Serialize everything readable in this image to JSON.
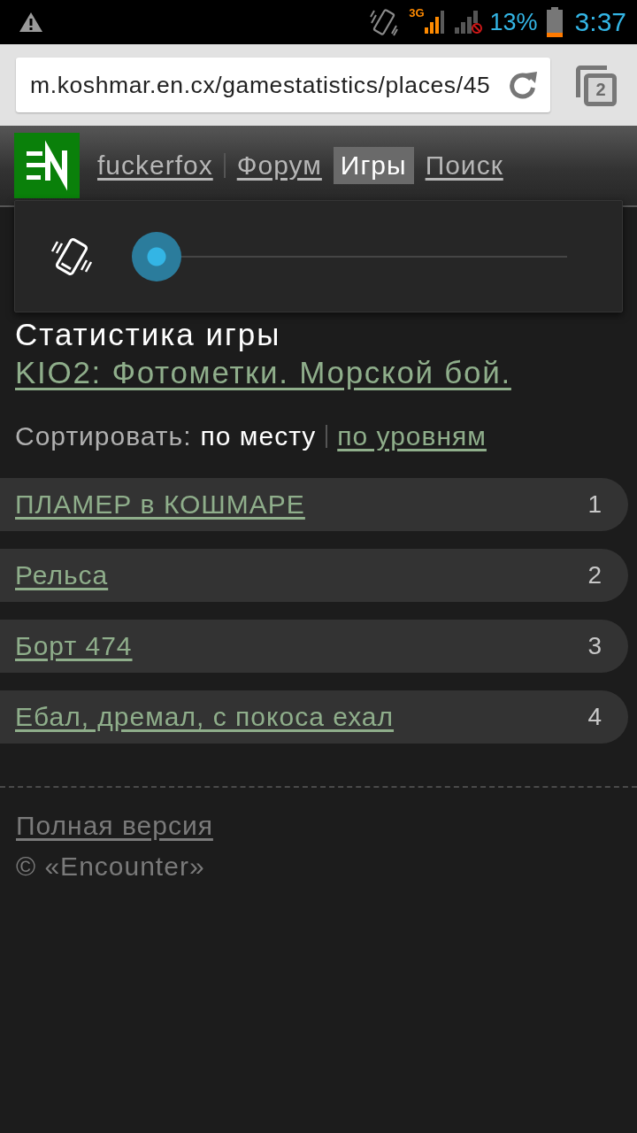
{
  "status_bar": {
    "network_type": "3G",
    "battery_percent": "13%",
    "time": "3:37"
  },
  "browser": {
    "url": "m.koshmar.en.cx/gamestatistics/places/45",
    "tab_count": "2"
  },
  "header": {
    "nav": [
      {
        "label": "fuckerfox",
        "kind": "user",
        "selected": false
      },
      {
        "label": "Форум",
        "kind": "link",
        "selected": false
      },
      {
        "label": "Игры",
        "kind": "link",
        "selected": true
      },
      {
        "label": "Поиск",
        "kind": "link",
        "selected": false
      }
    ]
  },
  "volume_dialog": {
    "level": 0
  },
  "page": {
    "title": "Статистика игры",
    "game_link": "KIO2: Фотометки. Морской бой.",
    "sort": {
      "label": "Сортировать:",
      "options": [
        {
          "label": "по месту",
          "selected": true
        },
        {
          "label": "по уровням",
          "selected": false
        }
      ]
    },
    "teams": [
      {
        "name": "ПЛАМЕР в КОШМАРЕ",
        "place": "1"
      },
      {
        "name": "Рельса",
        "place": "2"
      },
      {
        "name": "Борт 474",
        "place": "3"
      },
      {
        "name": "Ебал, дремал, с покоса ехал",
        "place": "4"
      }
    ]
  },
  "footer": {
    "full_version_link": "Полная версия",
    "copyright": "© «Encounter»"
  }
}
